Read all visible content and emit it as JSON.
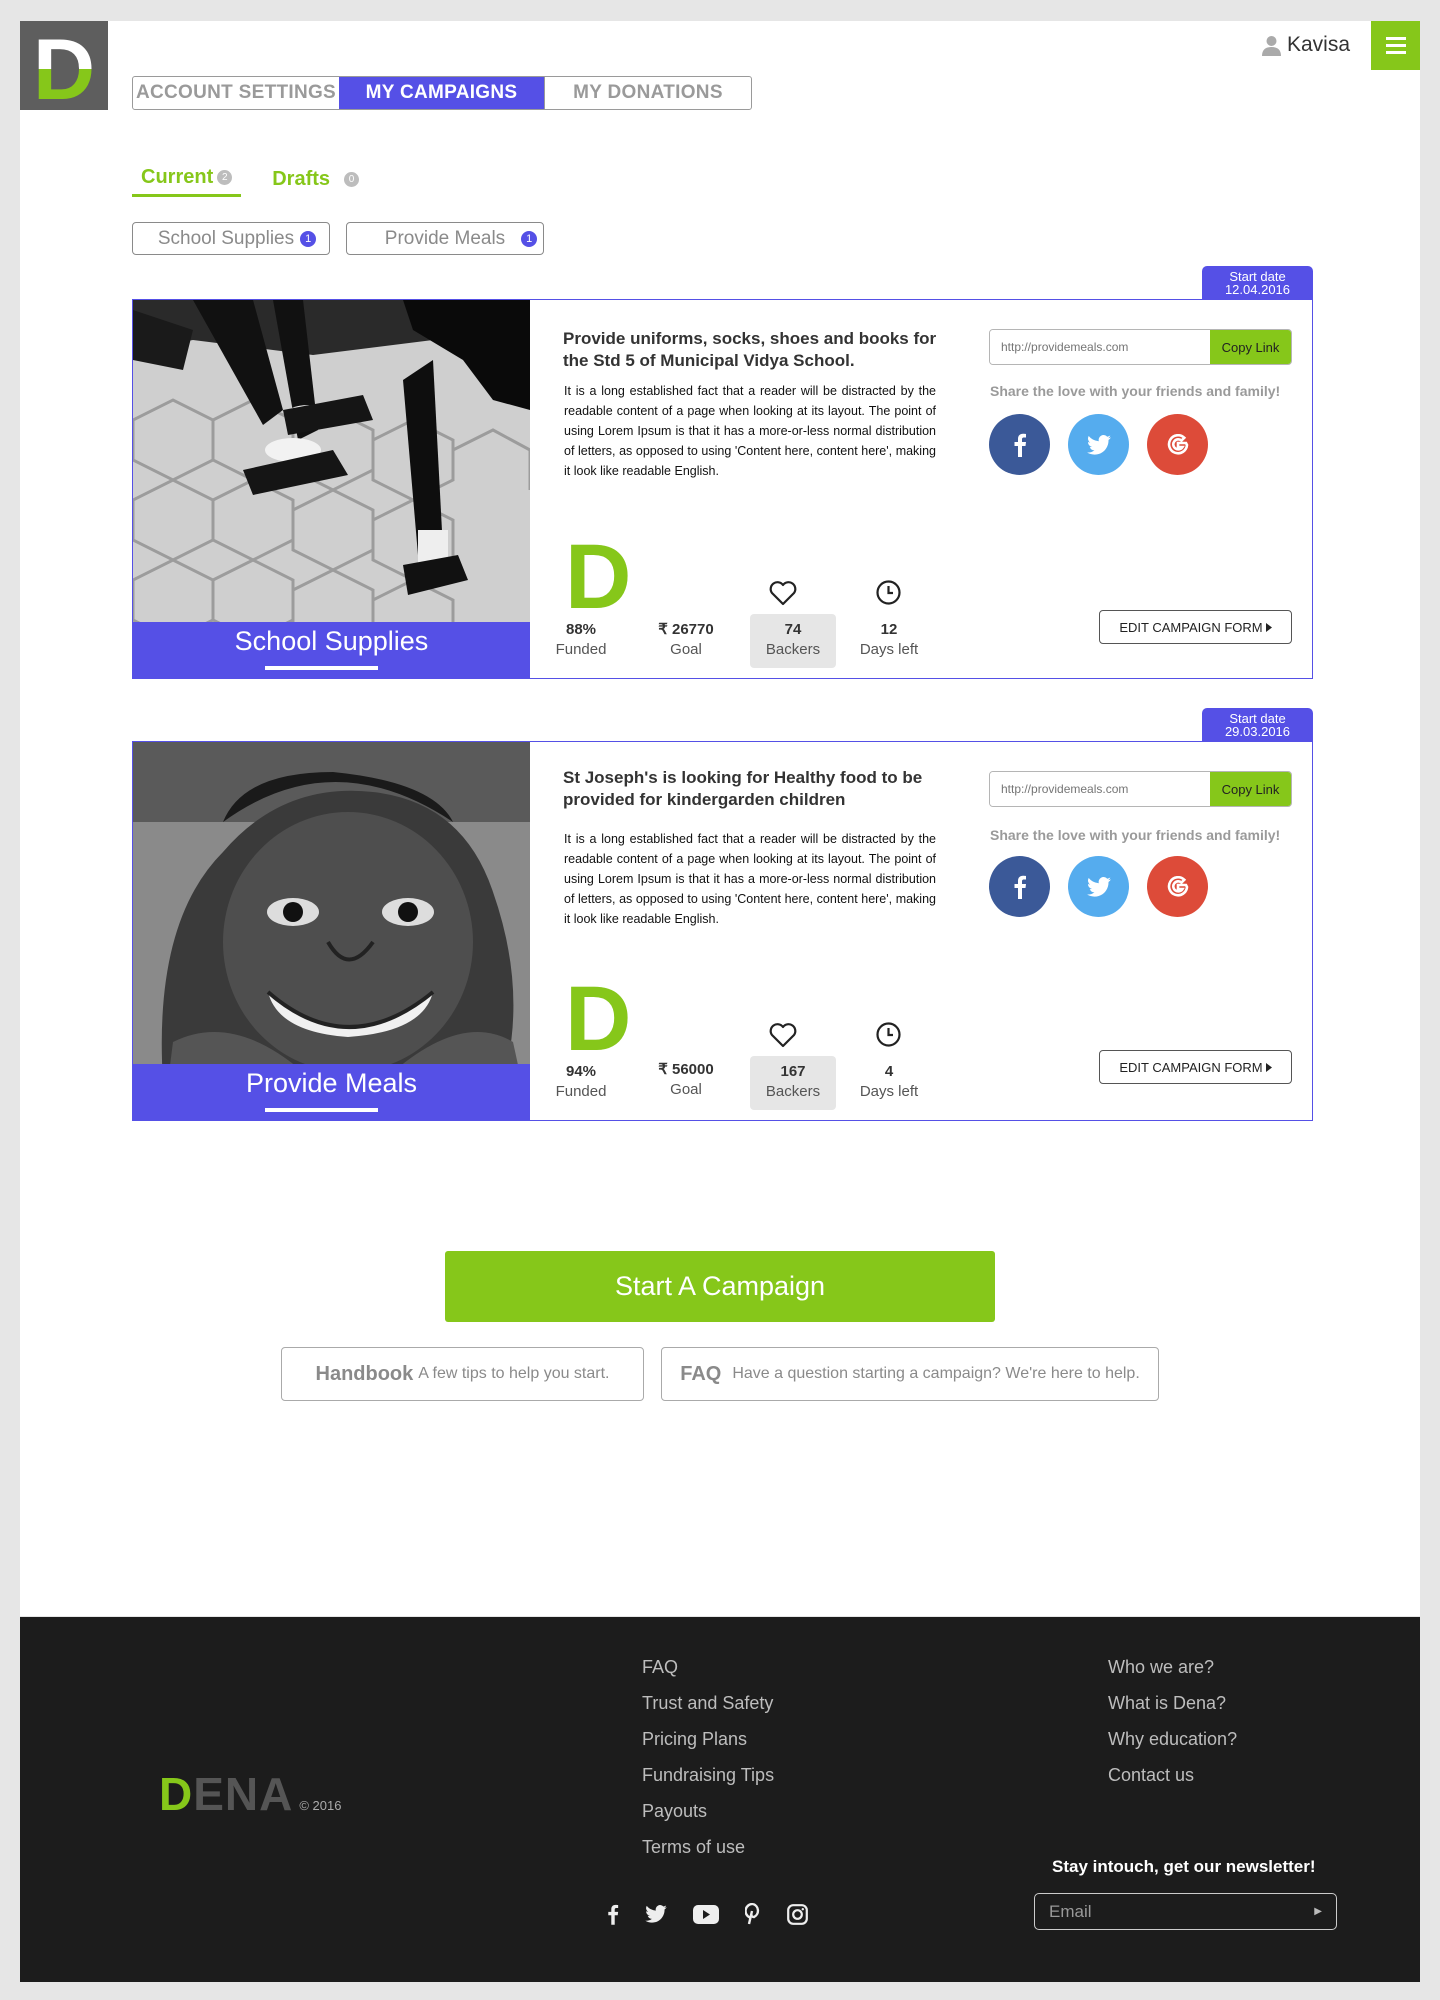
{
  "header": {
    "logo_letter": "D",
    "user_name": "Kavisa",
    "tabs": [
      {
        "label": "ACCOUNT SETTINGS",
        "active": false
      },
      {
        "label": "MY CAMPAIGNS",
        "active": true
      },
      {
        "label": "MY DONATIONS",
        "active": false
      }
    ]
  },
  "sub_tabs": [
    {
      "label": "Current",
      "count": "2",
      "active": true
    },
    {
      "label": "Drafts",
      "count": "0",
      "active": false
    }
  ],
  "filters": [
    {
      "label": "School Supplies",
      "count": "1"
    },
    {
      "label": "Provide Meals",
      "count": "1"
    }
  ],
  "campaigns": [
    {
      "start_label": "Start date",
      "start_date": "12.04.2016",
      "image_label": "School Supplies",
      "title": "Provide uniforms, socks, shoes and books for the Std 5 of Municipal Vidya School.",
      "description": "It is a long established fact that a reader will be distracted by the readable content of a page when looking at its layout. The point of using Lorem Ipsum is that it has a more-or-less normal distribution of letters, as opposed to using 'Content here, content here', making it look like readable English.",
      "funded": "88%",
      "funded_label": "Funded",
      "goal": "₹ 26770",
      "goal_label": "Goal",
      "backers": "74",
      "backers_label": "Backers",
      "days": "12",
      "days_label": "Days left",
      "link_placeholder": "http://providemeals.com",
      "copy_label": "Copy Link",
      "share_text": "Share the love with your friends and family!",
      "edit_label": "EDIT CAMPAIGN FORM"
    },
    {
      "start_label": "Start date",
      "start_date": "29.03.2016",
      "image_label": "Provide Meals",
      "title": "St Joseph's is looking for Healthy food to be provided for kindergarden children",
      "description": "It is a long established fact that a reader will be distracted by the readable content of a page when looking at its layout. The point of using Lorem Ipsum is that it has a more-or-less normal distribution of letters, as opposed to using 'Content here, content here', making it look like readable English.",
      "funded": "94%",
      "funded_label": "Funded",
      "goal": "₹ 56000",
      "goal_label": "Goal",
      "backers": "167",
      "backers_label": "Backers",
      "days": "4",
      "days_label": "Days left",
      "link_placeholder": "http://providemeals.com",
      "copy_label": "Copy Link",
      "share_text": "Share the love with your friends and family!",
      "edit_label": "EDIT CAMPAIGN FORM"
    }
  ],
  "cta": {
    "start_campaign": "Start A Campaign",
    "handbook_title": "Handbook",
    "handbook_text": "A few tips to help you start.",
    "faq_title": "FAQ",
    "faq_text": "Have a question starting a campaign? We're here to help."
  },
  "footer": {
    "brand_green": "D",
    "brand_rest": "ENA",
    "copyright": "© 2016",
    "links_col1": [
      "FAQ",
      "Trust and Safety",
      "Pricing Plans",
      "Fundraising Tips",
      "Payouts",
      "Terms of use"
    ],
    "links_col2": [
      "Who we are?",
      "What is Dena?",
      "Why education?",
      "Contact us"
    ],
    "newsletter_title": "Stay intouch, get our newsletter!",
    "email_placeholder": "Email",
    "social_icons": [
      "facebook-icon",
      "twitter-icon",
      "youtube-icon",
      "pinterest-icon",
      "instagram-icon"
    ]
  },
  "colors": {
    "accent_green": "#86c71a",
    "accent_purple": "#5550e6",
    "facebook": "#3b5998",
    "twitter": "#55acee",
    "google": "#dd4b39",
    "footer_bg": "#1c1c1c"
  }
}
